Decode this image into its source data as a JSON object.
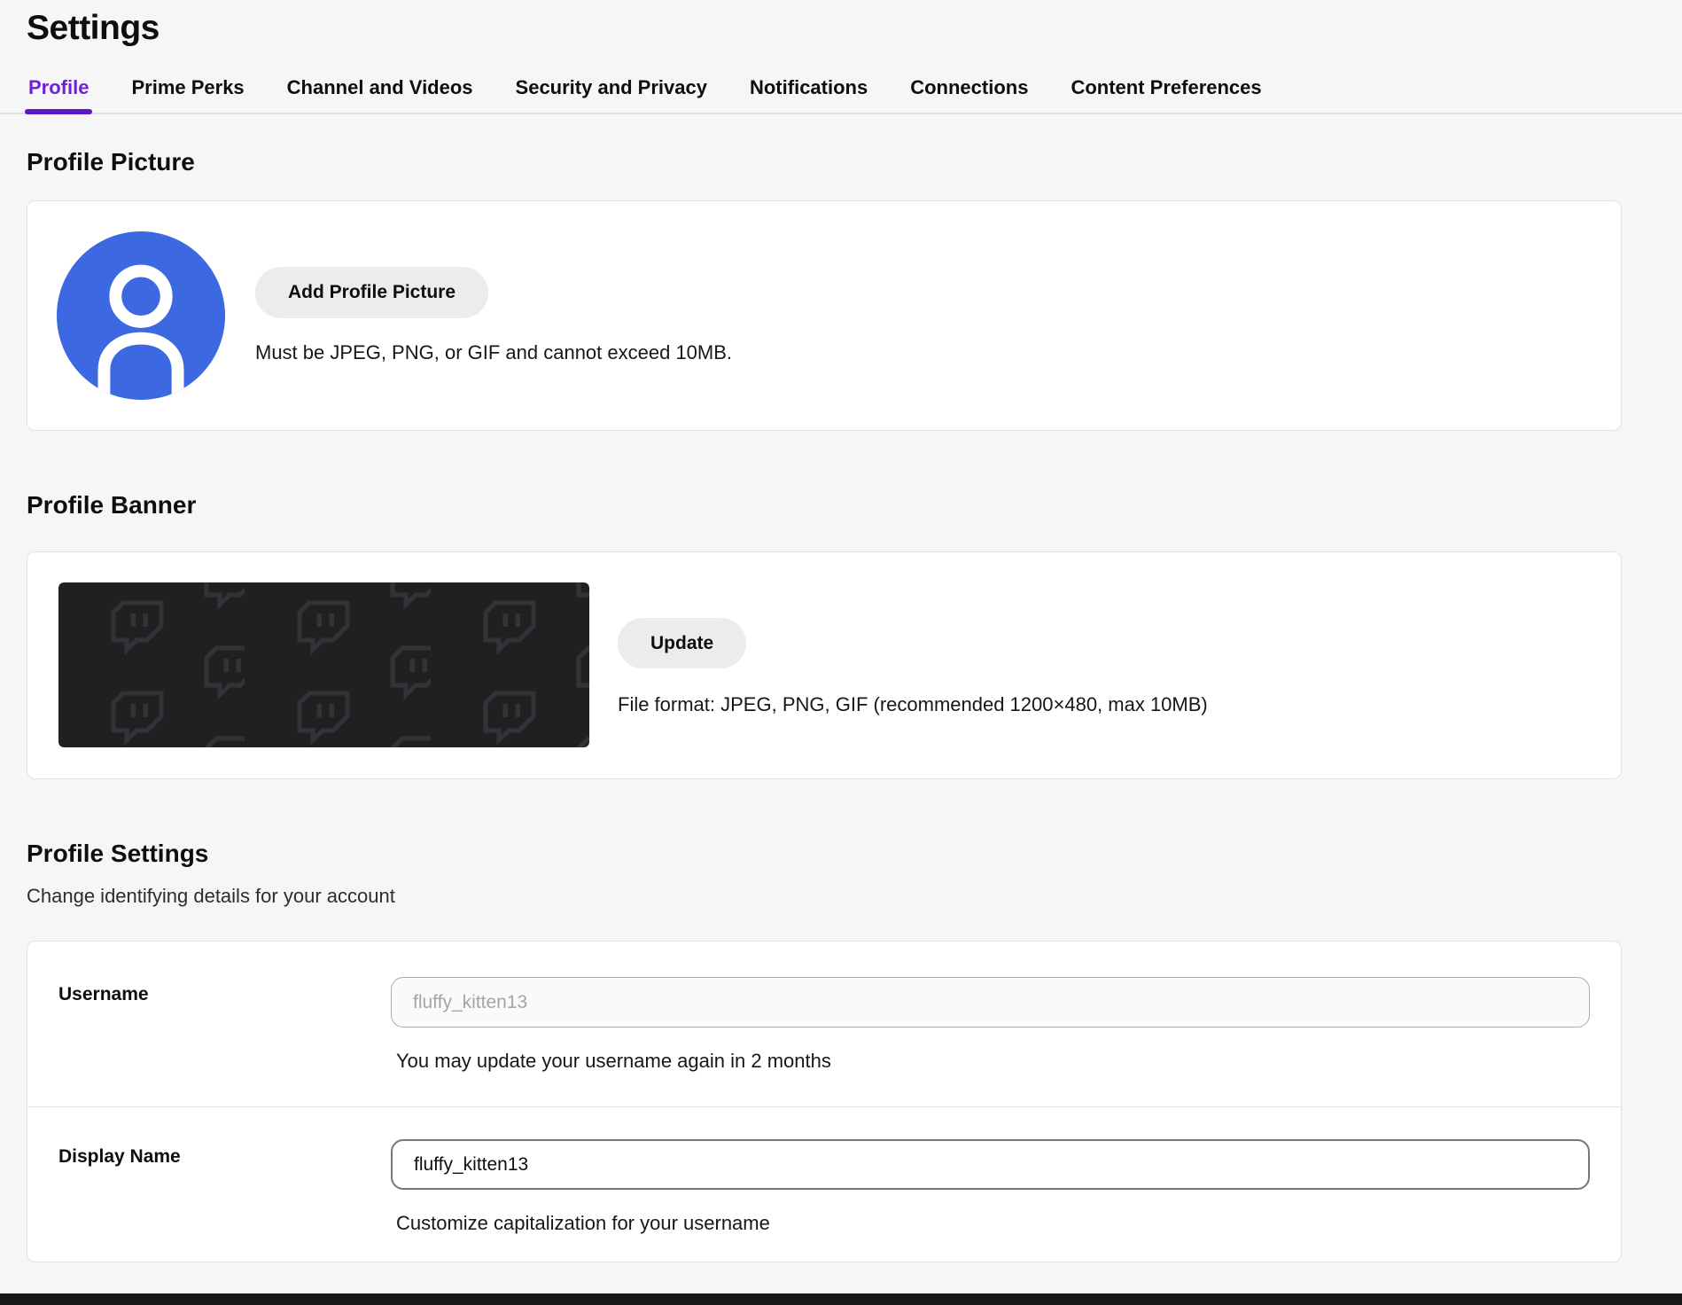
{
  "page": {
    "title": "Settings",
    "colors": {
      "accent_purple": "#5c16c5",
      "active_tab_text": "#6c21d9",
      "avatar_blue": "#3c68e2",
      "banner_background": "#202022",
      "banner_logo": "#333337",
      "bottom_bar": "#17171a",
      "page_background": "#f6f6f7"
    }
  },
  "tabs": [
    {
      "label": "Profile",
      "active": true
    },
    {
      "label": "Prime Perks",
      "active": false
    },
    {
      "label": "Channel and Videos",
      "active": false
    },
    {
      "label": "Security and Privacy",
      "active": false
    },
    {
      "label": "Notifications",
      "active": false
    },
    {
      "label": "Connections",
      "active": false
    },
    {
      "label": "Content Preferences",
      "active": false
    }
  ],
  "profile_picture": {
    "heading": "Profile Picture",
    "button_label": "Add Profile Picture",
    "hint": "Must be JPEG, PNG, or GIF and cannot exceed 10MB.",
    "avatar_icon": "person-icon"
  },
  "profile_banner": {
    "heading": "Profile Banner",
    "button_label": "Update",
    "hint": "File format: JPEG, PNG, GIF (recommended 1200×480, max 10MB)",
    "preview_icon": "twitch-logo-pattern"
  },
  "profile_settings": {
    "heading": "Profile Settings",
    "subheading": "Change identifying details for your account",
    "username": {
      "label": "Username",
      "value": "fluffy_kitten13",
      "disabled": true,
      "helper": "You may update your username again in 2 months"
    },
    "display_name": {
      "label": "Display Name",
      "value": "fluffy_kitten13",
      "disabled": false,
      "helper": "Customize capitalization for your username"
    }
  }
}
